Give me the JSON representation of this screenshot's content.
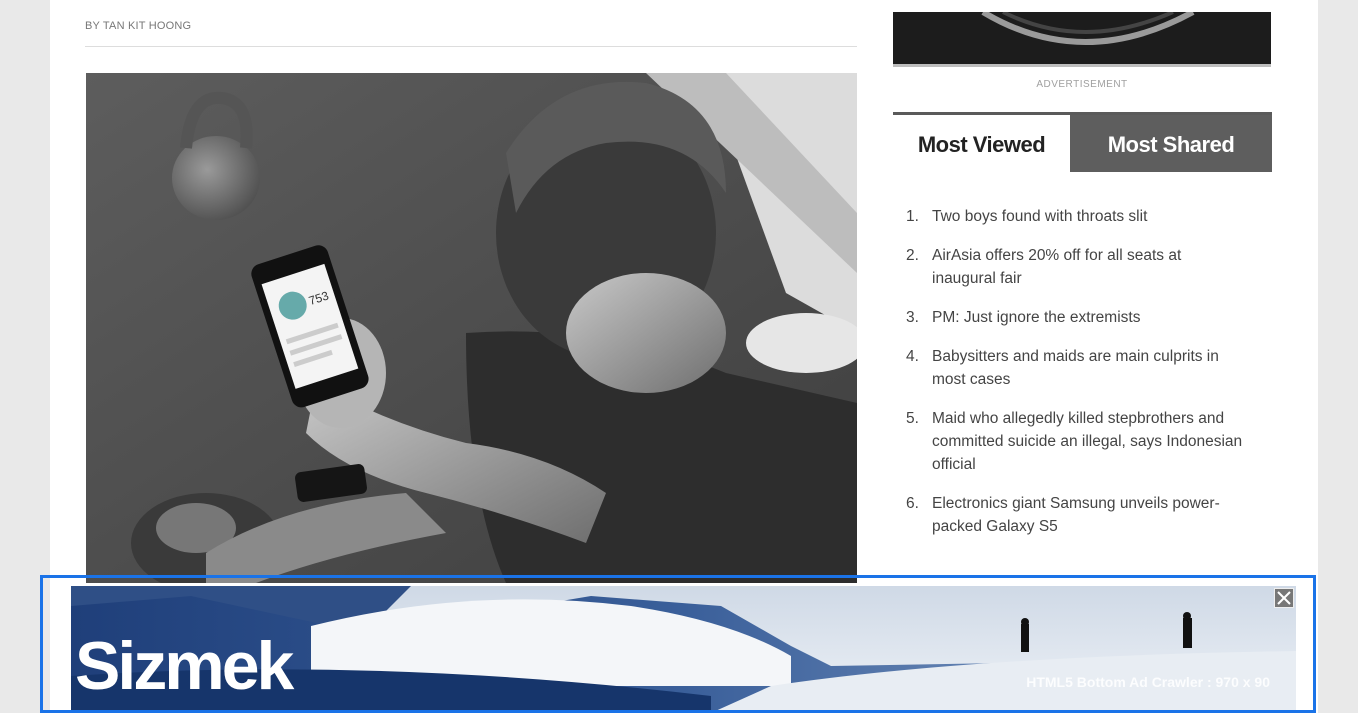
{
  "article": {
    "byline": "BY TAN KIT HOONG",
    "photo_icon": "man-with-smartphone-photo"
  },
  "sidebar": {
    "ad_label": "ADVERTISEMENT",
    "tabs": [
      {
        "label": "Most Viewed",
        "active": true
      },
      {
        "label": "Most Shared",
        "active": false
      }
    ],
    "most_viewed": [
      {
        "num": "1.",
        "title": "Two boys found with throats slit"
      },
      {
        "num": "2.",
        "title": "AirAsia offers 20% off for all seats at inaugural fair"
      },
      {
        "num": "3.",
        "title": "PM: Just ignore the extremists"
      },
      {
        "num": "4.",
        "title": "Babysitters and maids are main culprits in most cases"
      },
      {
        "num": "5.",
        "title": "Maid who allegedly killed stepbrothers and committed suicide an illegal, says Indonesian official"
      },
      {
        "num": "6.",
        "title": "Electronics giant Samsung unveils power-packed Galaxy S5"
      }
    ]
  },
  "bottom_ad": {
    "brand": "Sizmek",
    "label": "HTML5 Bottom Ad Crawler : 970 x 90",
    "close_icon": "close-icon"
  },
  "colors": {
    "highlight_border": "#1a73e8",
    "tab_inactive_bg": "#5e5e5e"
  }
}
